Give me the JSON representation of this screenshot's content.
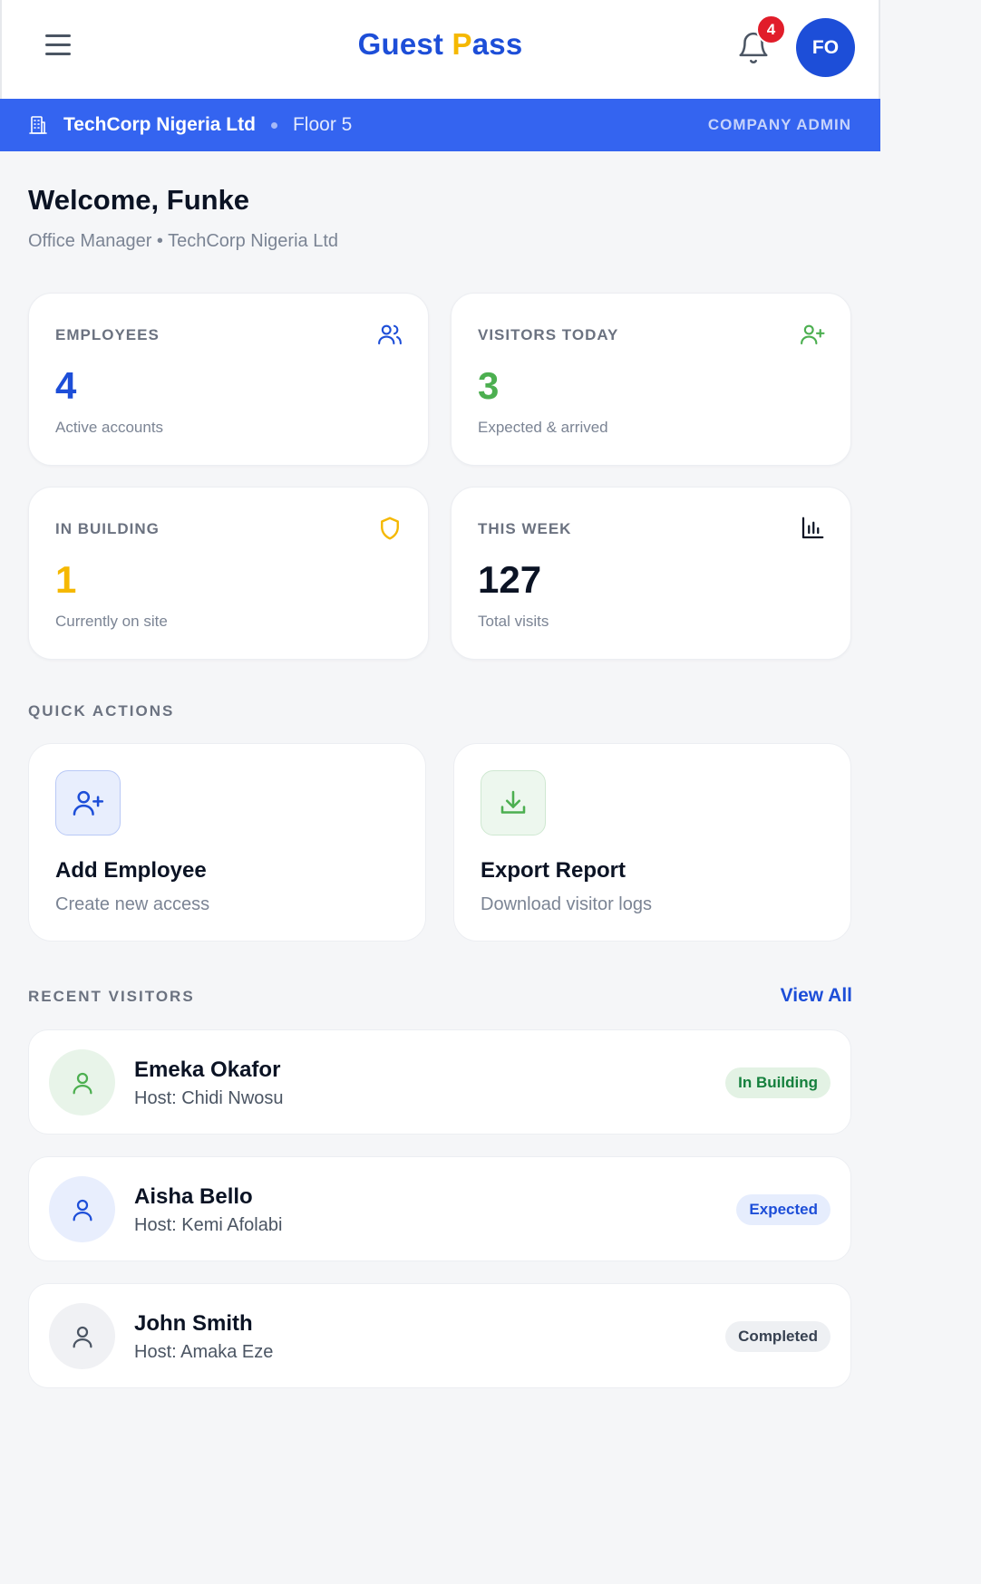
{
  "header": {
    "logo_first": "Guest",
    "logo_p": "P",
    "logo_rest": "ass",
    "notification_count": "4",
    "avatar_initials": "FO"
  },
  "company_bar": {
    "name": "TechCorp Nigeria Ltd",
    "floor": "Floor 5",
    "role": "COMPANY ADMIN"
  },
  "welcome": {
    "title": "Welcome, Funke",
    "subtitle": "Office Manager • TechCorp Nigeria Ltd"
  },
  "stats": [
    {
      "label": "EMPLOYEES",
      "value": "4",
      "sub": "Active accounts",
      "icon": "users-icon",
      "color": "#1d4ed8"
    },
    {
      "label": "VISITORS TODAY",
      "value": "3",
      "sub": "Expected & arrived",
      "icon": "user-plus-icon",
      "color": "#4caf50"
    },
    {
      "label": "IN BUILDING",
      "value": "1",
      "sub": "Currently on site",
      "icon": "shield-icon",
      "color": "#f5b800"
    },
    {
      "label": "THIS WEEK",
      "value": "127",
      "sub": "Total visits",
      "icon": "bar-chart-icon",
      "color": "#0b1324"
    }
  ],
  "quick_actions": {
    "title": "QUICK ACTIONS",
    "items": [
      {
        "title": "Add Employee",
        "sub": "Create new access",
        "icon": "user-plus-icon"
      },
      {
        "title": "Export Report",
        "sub": "Download visitor logs",
        "icon": "download-icon"
      }
    ]
  },
  "recent_visitors": {
    "title": "RECENT VISITORS",
    "view_all": "View All",
    "items": [
      {
        "name": "Emeka Okafor",
        "host": "Host: Chidi Nwosu",
        "status": "In Building",
        "status_color": "#15803d"
      },
      {
        "name": "Aisha Bello",
        "host": "Host: Kemi Afolabi",
        "status": "Expected",
        "status_color": "#1d4ed8"
      },
      {
        "name": "John Smith",
        "host": "Host: Amaka Eze",
        "status": "Completed",
        "status_color": "#374151"
      }
    ]
  }
}
